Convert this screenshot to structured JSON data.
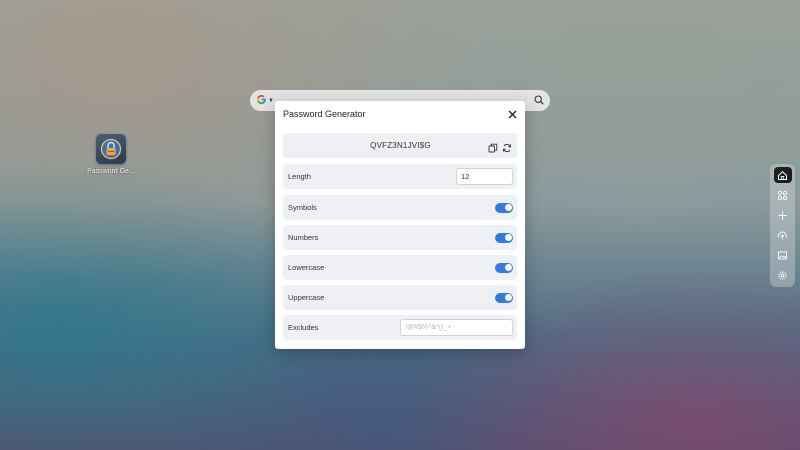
{
  "desktop": {
    "icon_label": "Password Ge...",
    "icon_name": "password-generator-app-icon"
  },
  "searchbar": {
    "engine_icon": "google-icon",
    "search_icon": "search-icon"
  },
  "dialog": {
    "title": "Password Generator",
    "close_icon": "close-icon",
    "password": "QVFZ3N1JVI$G",
    "length_label": "Length",
    "length_value": "12",
    "options": [
      {
        "label": "Symbols",
        "enabled": true
      },
      {
        "label": "Numbers",
        "enabled": true
      },
      {
        "label": "Lowercase",
        "enabled": true
      },
      {
        "label": "Uppercase",
        "enabled": true
      }
    ],
    "excludes_label": "Excludes",
    "excludes_placeholder": "!@#$%^&*()_+",
    "excludes_value": ""
  },
  "dock": {
    "items": [
      "home-icon",
      "apps-icon",
      "add-icon",
      "upload-icon",
      "image-icon",
      "settings-icon"
    ],
    "active": "home-icon"
  },
  "colors": {
    "accent": "#2f7de1",
    "dock_active": "#1e1e1e"
  }
}
